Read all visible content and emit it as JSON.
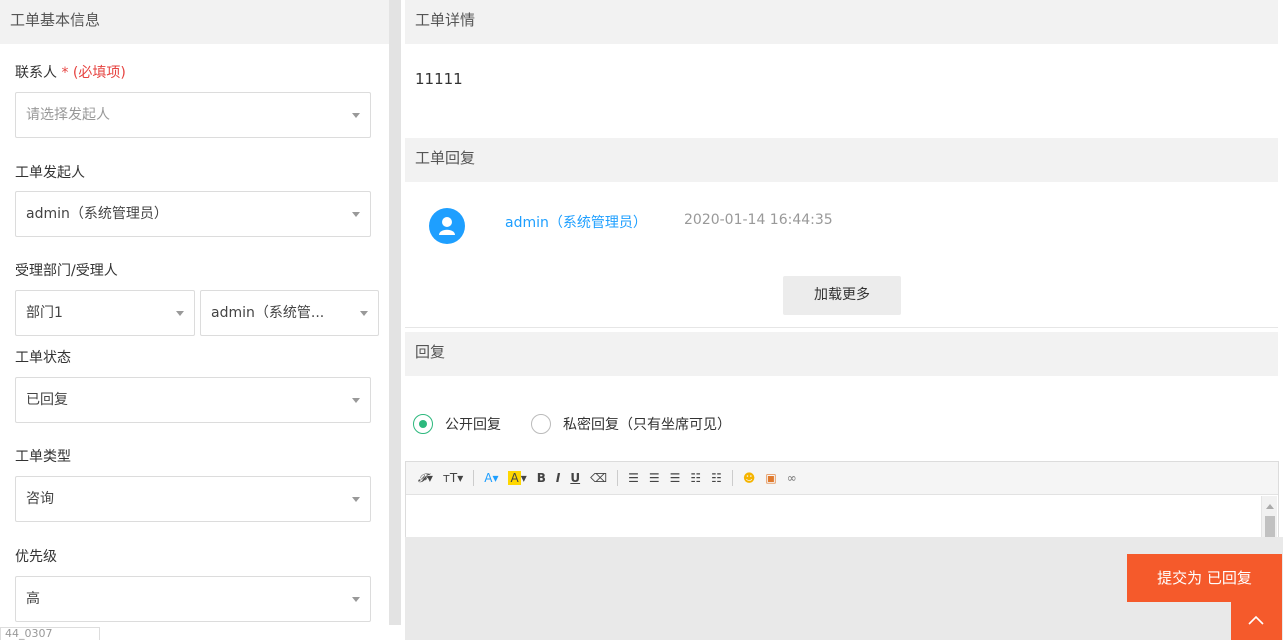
{
  "left": {
    "header": "工单基本信息",
    "contact": {
      "label": "联系人",
      "asterisk": "*",
      "required_note": "(必填项)",
      "placeholder": "请选择发起人"
    },
    "initiator": {
      "label": "工单发起人",
      "value": "admin（系统管理员）"
    },
    "handler": {
      "label": "受理部门/受理人",
      "department": "部门1",
      "person": "admin（系统管..."
    },
    "status": {
      "label": "工单状态",
      "value": "已回复"
    },
    "type": {
      "label": "工单类型",
      "value": "咨询"
    },
    "priority": {
      "label": "优先级",
      "value": "高"
    },
    "bottom_tag": "44_0307"
  },
  "right": {
    "detail_header": "工单详情",
    "detail_text": "11111",
    "reply_header": "工单回复",
    "reply": {
      "user": "admin（系统管理员）",
      "time": "2020-01-14 16:44:35"
    },
    "load_more": "加载更多",
    "respond_header": "回复",
    "radio_public": "公开回复",
    "radio_private": "私密回复（只有坐席可见）",
    "submit": "提交为 已回复"
  },
  "colors": {
    "accent": "#1e9fff",
    "submit": "#f55a2b",
    "radio": "#2db87d",
    "required": "#e64340"
  }
}
